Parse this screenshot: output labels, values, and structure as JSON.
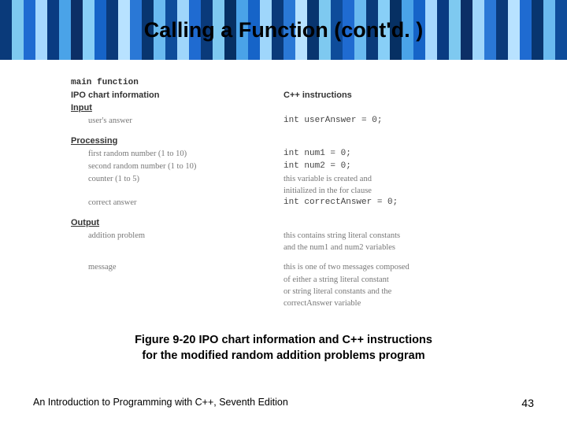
{
  "title": "Calling a Function (cont'd. )",
  "section": {
    "fn_name": "main function",
    "ipo_label": "IPO chart information",
    "cpp_label": "C++ instructions",
    "input_label": "Input",
    "processing_label": "Processing",
    "output_label": "Output"
  },
  "input": {
    "item1": "user's answer",
    "code1": "int userAnswer = 0;"
  },
  "processing": {
    "item1": "first random number (1 to 10)",
    "item2": "second random number (1 to 10)",
    "item3": "counter (1 to 5)",
    "item4": "correct answer",
    "code1": "int num1 = 0;",
    "code2": "int num2 = 0;",
    "note1a": "this variable is created and",
    "note1b": "initialized in the for clause",
    "code3": "int correctAnswer = 0;"
  },
  "output": {
    "item1": "addition problem",
    "note1a": "this contains string literal constants",
    "note1b": "and the num1 and num2 variables",
    "item2": "message",
    "note2a": "this is one of two messages composed",
    "note2b": "of either a string literal constant",
    "note2c": "or string literal constants and the",
    "note2d": "correctAnswer variable"
  },
  "caption_line1": "Figure 9-20 IPO chart information and C++ instructions",
  "caption_line2": "for the modified random addition problems program",
  "footer_text": "An Introduction to Programming with C++, Seventh Edition",
  "page_number": "43",
  "banner_colors": [
    "#0a3a7a",
    "#7ec9f0",
    "#1f6bd1",
    "#a6d8ff",
    "#093b82",
    "#4aa3e8",
    "#0c2f66",
    "#88cff7",
    "#1664c8",
    "#0a3a7a",
    "#b8e2ff",
    "#2a78d6",
    "#08356f",
    "#6abaf0",
    "#0e4c9a",
    "#9fd6fb",
    "#1f6bd1",
    "#0a3a7a",
    "#7ec9f0",
    "#063063",
    "#4aa3e8",
    "#1664c8",
    "#9fd6fb",
    "#0a3a7a",
    "#2a78d6",
    "#b8e2ff",
    "#08356f",
    "#7ec9f0",
    "#0e4c9a",
    "#1f6bd1",
    "#6abaf0",
    "#0a3a7a",
    "#88cff7",
    "#063063",
    "#4aa3e8",
    "#1664c8",
    "#a6d8ff",
    "#093b82",
    "#7ec9f0",
    "#0c2f66",
    "#9fd6fb",
    "#2a78d6",
    "#0a3a7a",
    "#b8e2ff",
    "#1f6bd1",
    "#08356f",
    "#6abaf0",
    "#0e4c9a"
  ]
}
